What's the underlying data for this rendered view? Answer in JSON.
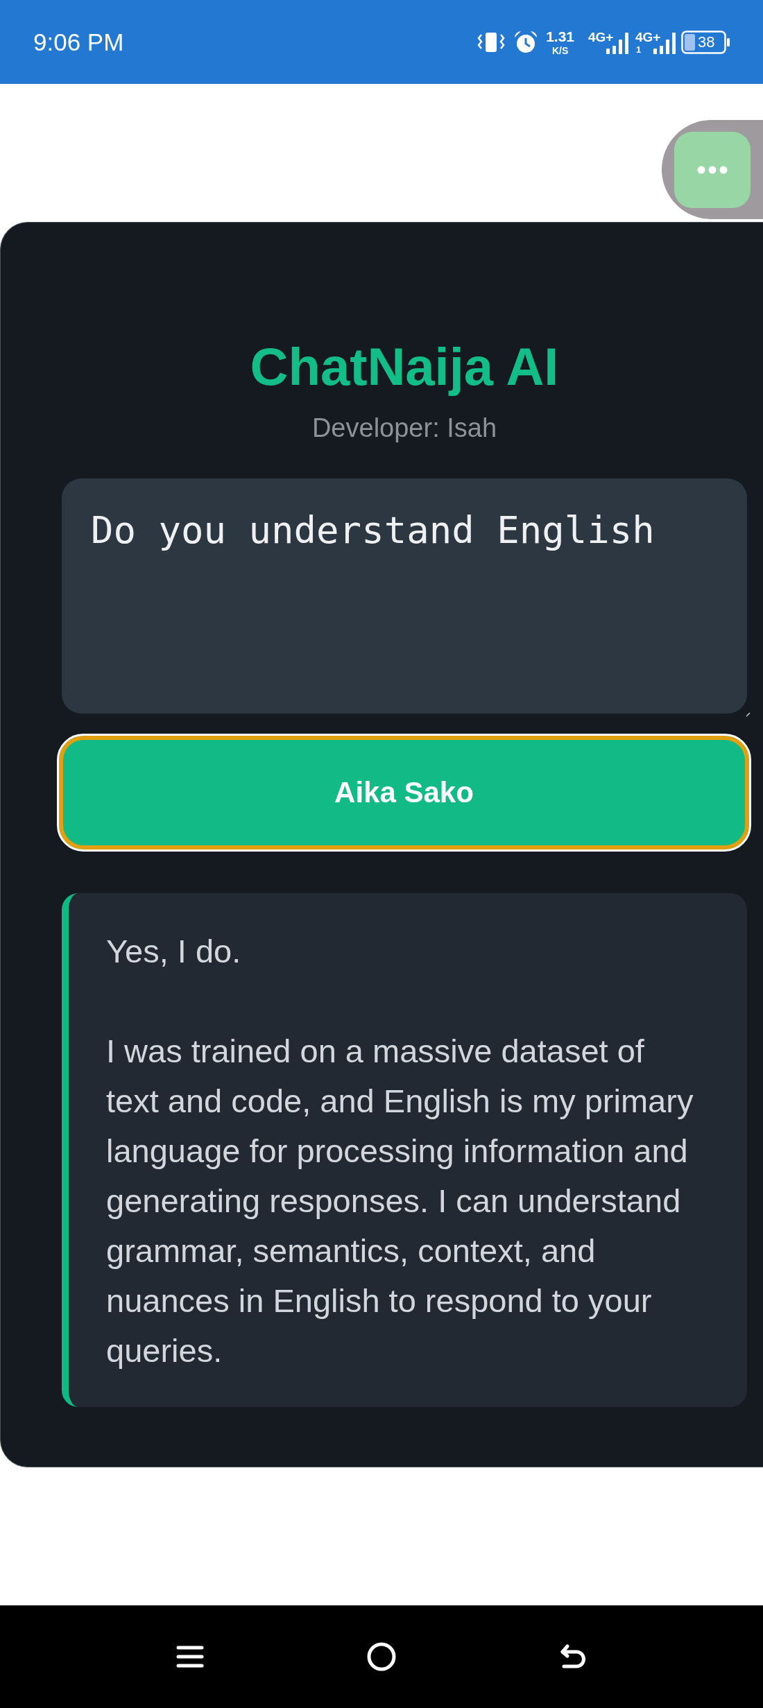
{
  "status_bar": {
    "time": "9:06 PM",
    "net_speed": "1.31",
    "net_speed_unit": "K/S",
    "signals": [
      {
        "network": "4G+"
      },
      {
        "network": "4G+",
        "slot": "1"
      }
    ],
    "battery": "38"
  },
  "app": {
    "title": "ChatNaija AI",
    "subtitle": "Developer: Isah"
  },
  "prompt_input": {
    "value": "Do you understand English"
  },
  "submit_button": {
    "label": "Aika Sako",
    "focused": true
  },
  "response": {
    "paragraphs": [
      "Yes, I do.",
      "I was trained on a massive dataset of text and code, and English is my primary language for processing information and generating responses. I can understand grammar, semantics, context, and nuances in English to respond to your queries."
    ]
  }
}
